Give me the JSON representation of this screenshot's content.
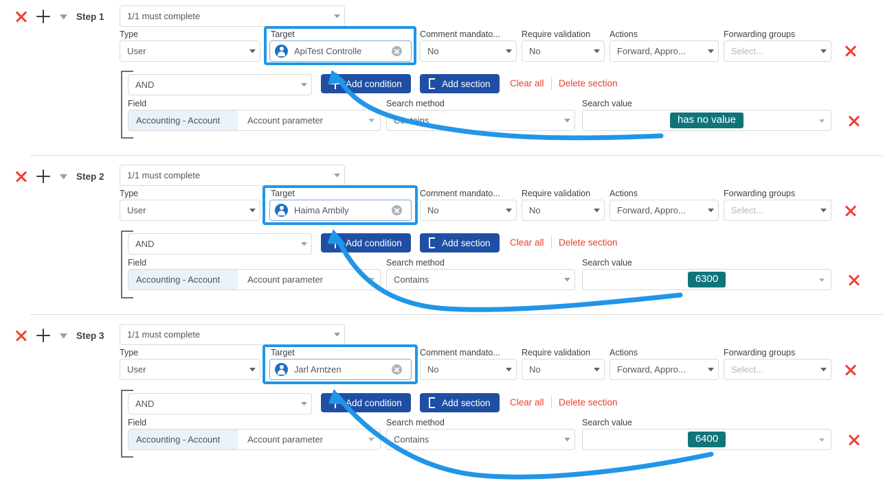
{
  "annotation": {
    "highlight_color": "#2196e8",
    "token_color": "#10757a",
    "arrow_color": "#2196e8"
  },
  "labels": {
    "type": "Type",
    "target": "Target",
    "comment_mandatory": "Comment mandato...",
    "require_validation": "Require validation",
    "actions": "Actions",
    "forwarding_groups": "Forwarding groups",
    "field": "Field",
    "search_method": "Search method",
    "search_value": "Search value"
  },
  "buttons": {
    "add_condition": "Add condition",
    "add_section": "Add section",
    "clear_all": "Clear all",
    "delete_section": "Delete section"
  },
  "steps": [
    {
      "name": "Step 1",
      "completion": "1/1 must complete",
      "type": "User",
      "target": "ApiTest Controlle",
      "comment_mandatory": "No",
      "require_validation": "No",
      "actions": "Forward, Appro...",
      "forwarding_groups_placeholder": "Select...",
      "logic_operator": "AND",
      "field_entity": "Accounting - Account",
      "field_parameter": "Account parameter",
      "search_method": "Contains",
      "search_value": "has no value"
    },
    {
      "name": "Step 2",
      "completion": "1/1 must complete",
      "type": "User",
      "target": "Haima Ambily",
      "comment_mandatory": "No",
      "require_validation": "No",
      "actions": "Forward, Appro...",
      "forwarding_groups_placeholder": "Select...",
      "logic_operator": "AND",
      "field_entity": "Accounting - Account",
      "field_parameter": "Account parameter",
      "search_method": "Contains",
      "search_value": "6300"
    },
    {
      "name": "Step 3",
      "completion": "1/1 must complete",
      "type": "User",
      "target": "Jarl Arntzen",
      "comment_mandatory": "No",
      "require_validation": "No",
      "actions": "Forward, Appro...",
      "forwarding_groups_placeholder": "Select...",
      "logic_operator": "AND",
      "field_entity": "Accounting - Account",
      "field_parameter": "Account parameter",
      "search_method": "Contains",
      "search_value": "6400"
    }
  ]
}
